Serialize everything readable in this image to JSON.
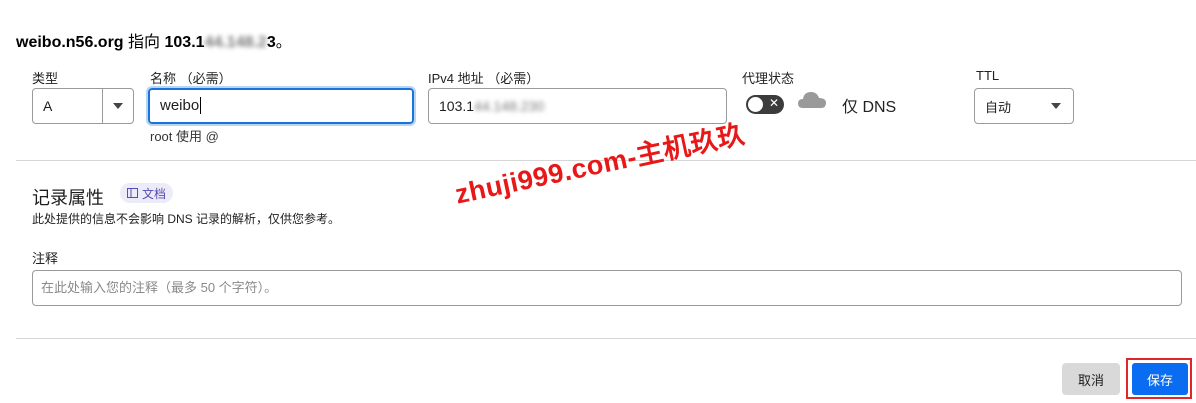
{
  "header": {
    "domain": "weibo.n56.org",
    "points_to": "指向",
    "ip_visible": "103.1",
    "ip_obscured": "44.148.2",
    "ip_tail": "3",
    "period": "。"
  },
  "form": {
    "type": {
      "label": "类型",
      "value": "A"
    },
    "name": {
      "label": "名称 （必需）",
      "value": "weibo",
      "hint": "root 使用 @"
    },
    "ipv4": {
      "label": "IPv4 地址 （必需）",
      "value_visible": "103.1",
      "value_obscured": "44.148.230"
    },
    "proxy": {
      "label": "代理状态",
      "status": "仅 DNS",
      "enabled": false
    },
    "ttl": {
      "label": "TTL",
      "value": "自动"
    }
  },
  "record_props": {
    "title": "记录属性",
    "doc_badge": "文档",
    "description": "此处提供的信息不会影响 DNS 记录的解析，仅供您参考。",
    "note_label": "注释",
    "note_placeholder": "在此处输入您的注释（最多 50 个字符）。"
  },
  "buttons": {
    "cancel": "取消",
    "save": "保存"
  },
  "watermark": "zhuji999.com-主机玖玖",
  "colors": {
    "primary": "#0a6cf0",
    "focus": "#1a73d9",
    "highlight": "#e0262a",
    "watermark": "#e81818"
  }
}
